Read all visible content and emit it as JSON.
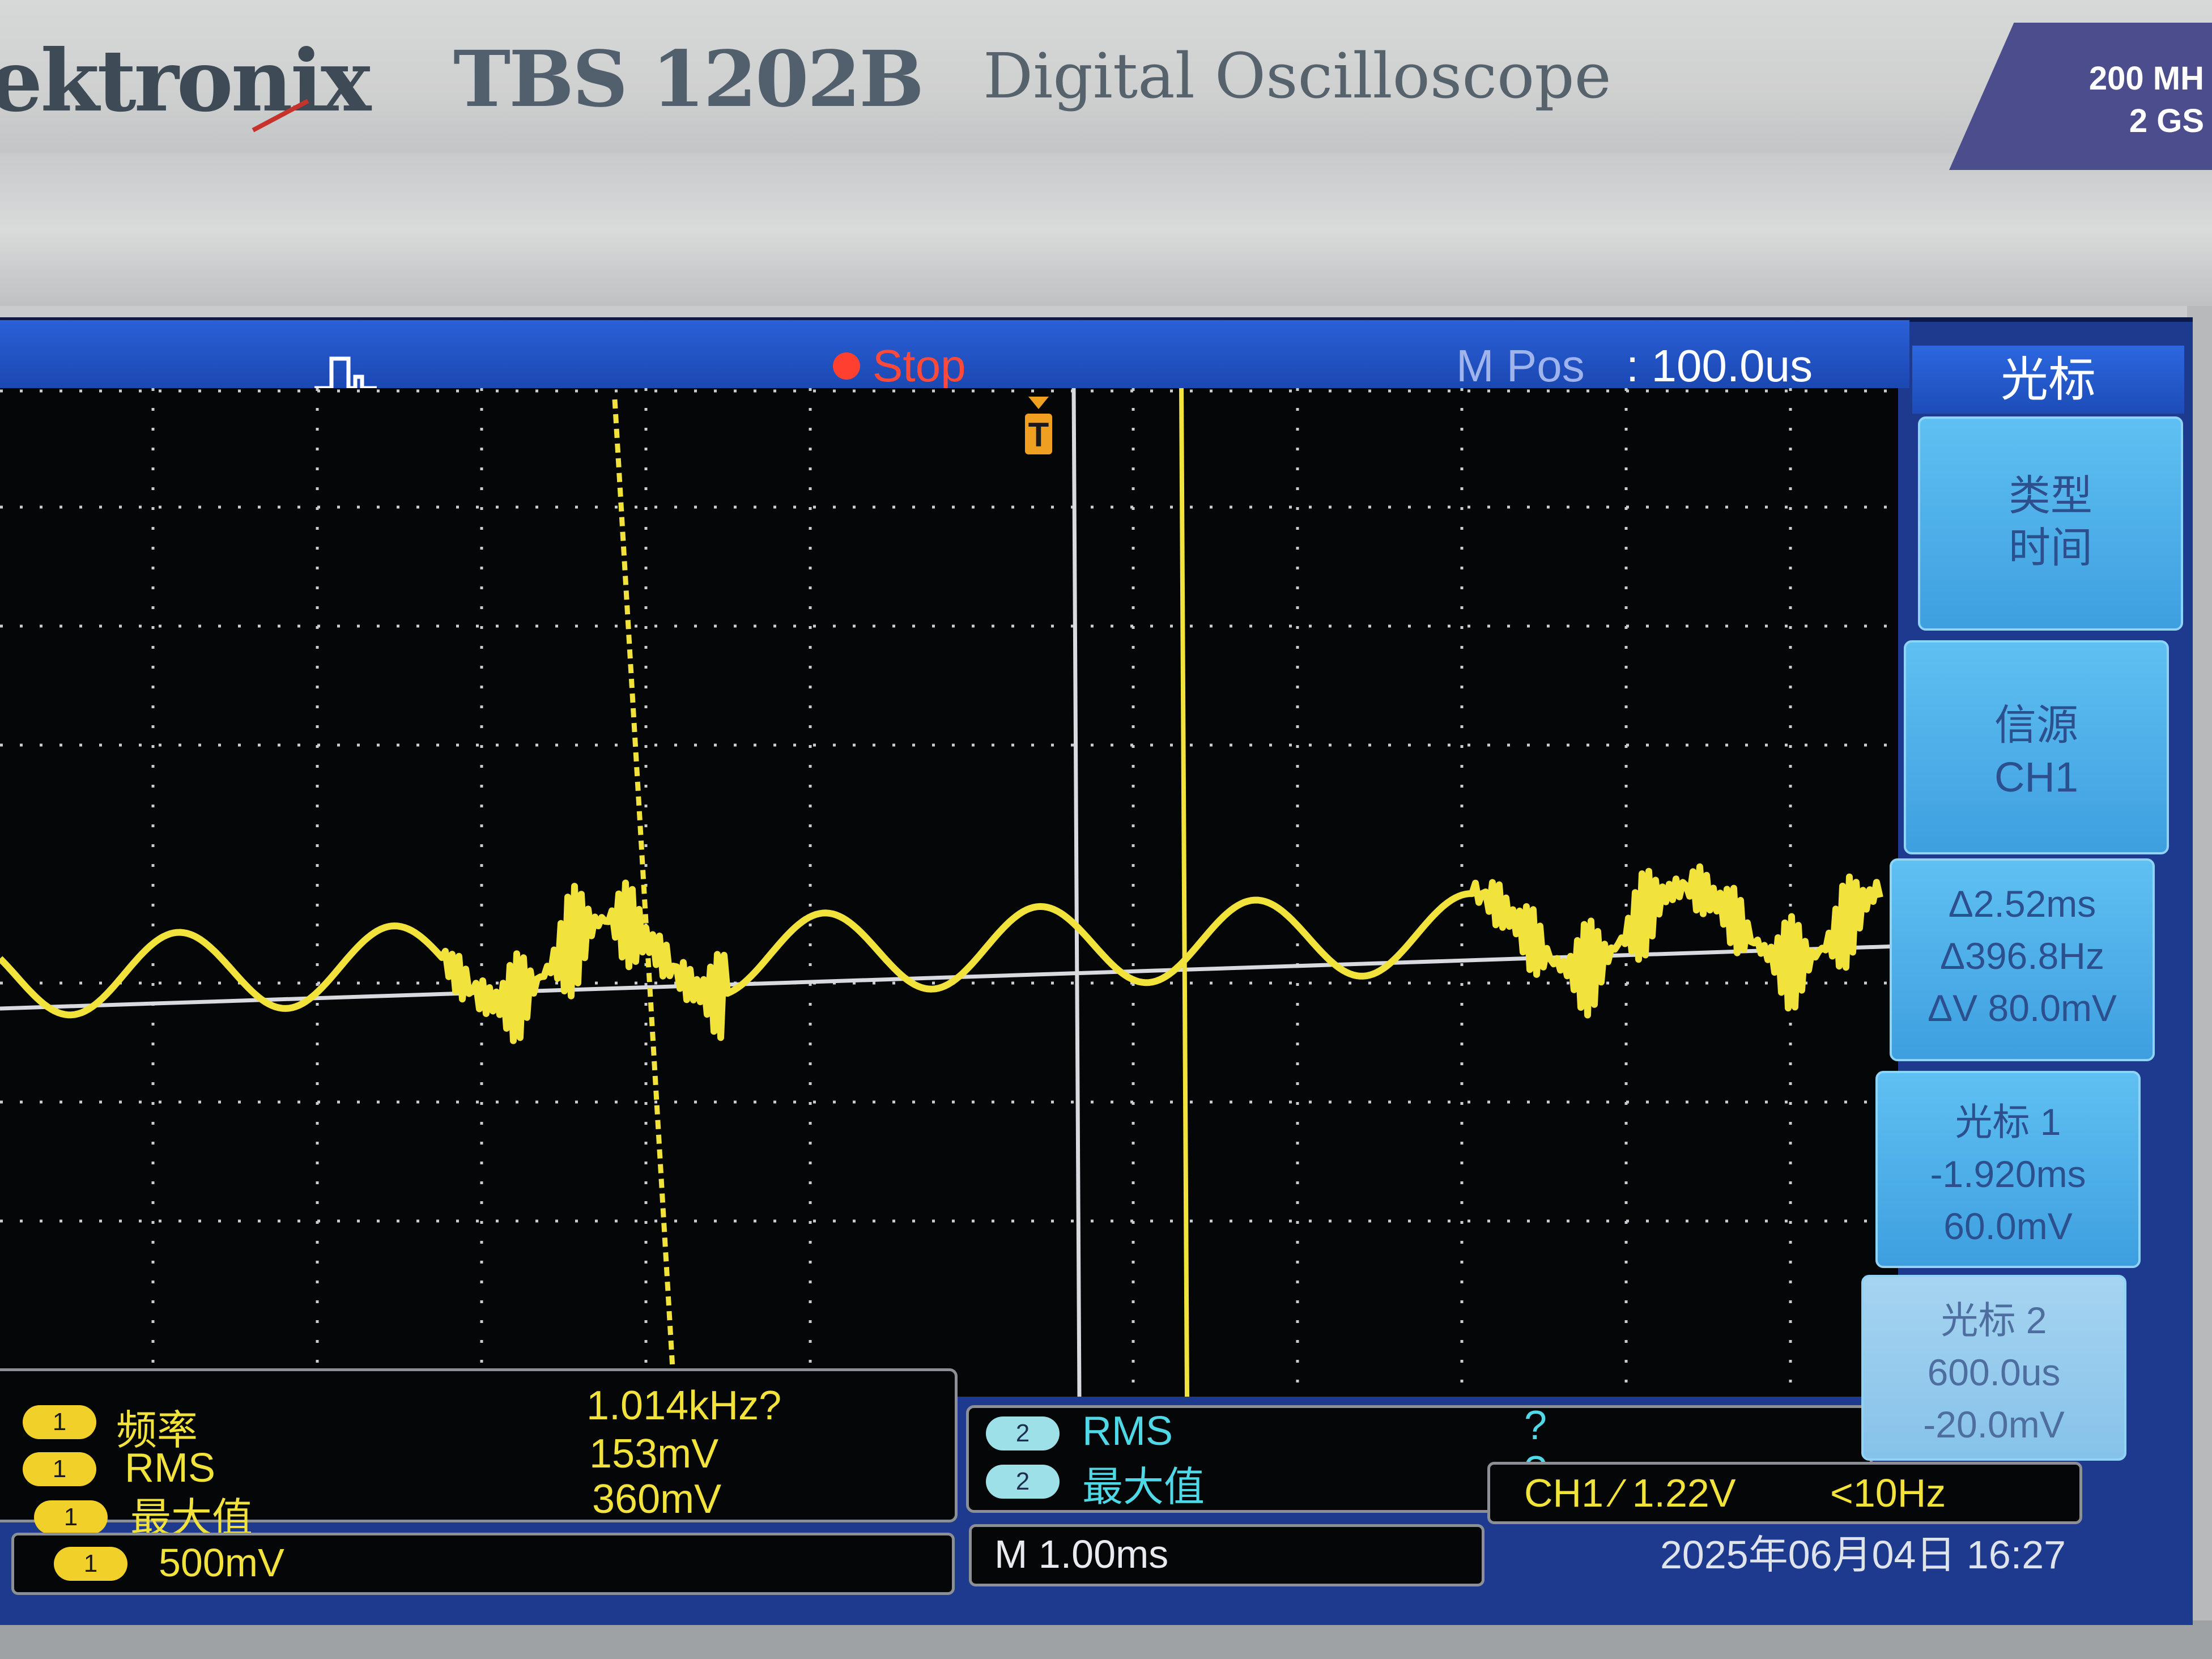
{
  "instrument": {
    "brand": "ektronix",
    "model": "TBS 1202B",
    "description": "Digital Oscilloscope",
    "spec_bandwidth": "200 MH",
    "spec_samplerate": "2 GS"
  },
  "status_bar": {
    "run_state": "Stop",
    "timebase_label": "M Pos",
    "timebase_position": ": 100.0us"
  },
  "colors": {
    "ch1": "#f2e23c",
    "ch2": "#4fd8e6",
    "stop": "#ff4a3a",
    "menu_button": "#4faee8"
  },
  "icons": {
    "trigger_type": "pulse-edge-icon",
    "stop": "record-dot-icon",
    "trigger_position": "trigger-t-marker-icon"
  },
  "measurements_ch1": [
    {
      "channel": "1",
      "name": "频率",
      "value": "1.014kHz?"
    },
    {
      "channel": "1",
      "name": "RMS",
      "value": "153mV"
    },
    {
      "channel": "1",
      "name": "最大值",
      "value": "360mV"
    }
  ],
  "measurements_ch2": [
    {
      "channel": "2",
      "name": "RMS",
      "value": "?"
    },
    {
      "channel": "2",
      "name": "最大值",
      "value": "?"
    }
  ],
  "ch1_scale": {
    "channel": "1",
    "value": "500mV"
  },
  "horizontal": {
    "scale": "M 1.00ms"
  },
  "trigger_info": {
    "source_level": "CH1 ∕ 1.22V",
    "frequency": "<10Hz"
  },
  "datetime": "2025年06月04日 16:27",
  "side_menu": {
    "title": "光标",
    "buttons": [
      {
        "lines": [
          "类型",
          "时间"
        ]
      },
      {
        "lines": [
          "信源",
          "CH1"
        ]
      },
      {
        "lines": [
          "Δ2.52ms",
          "Δ396.8Hz",
          "ΔV 80.0mV"
        ]
      },
      {
        "lines": [
          "光标 1",
          "-1.920ms",
          "60.0mV"
        ]
      },
      {
        "lines": [
          "光标 2",
          "600.0us",
          "-20.0mV"
        ]
      }
    ]
  }
}
